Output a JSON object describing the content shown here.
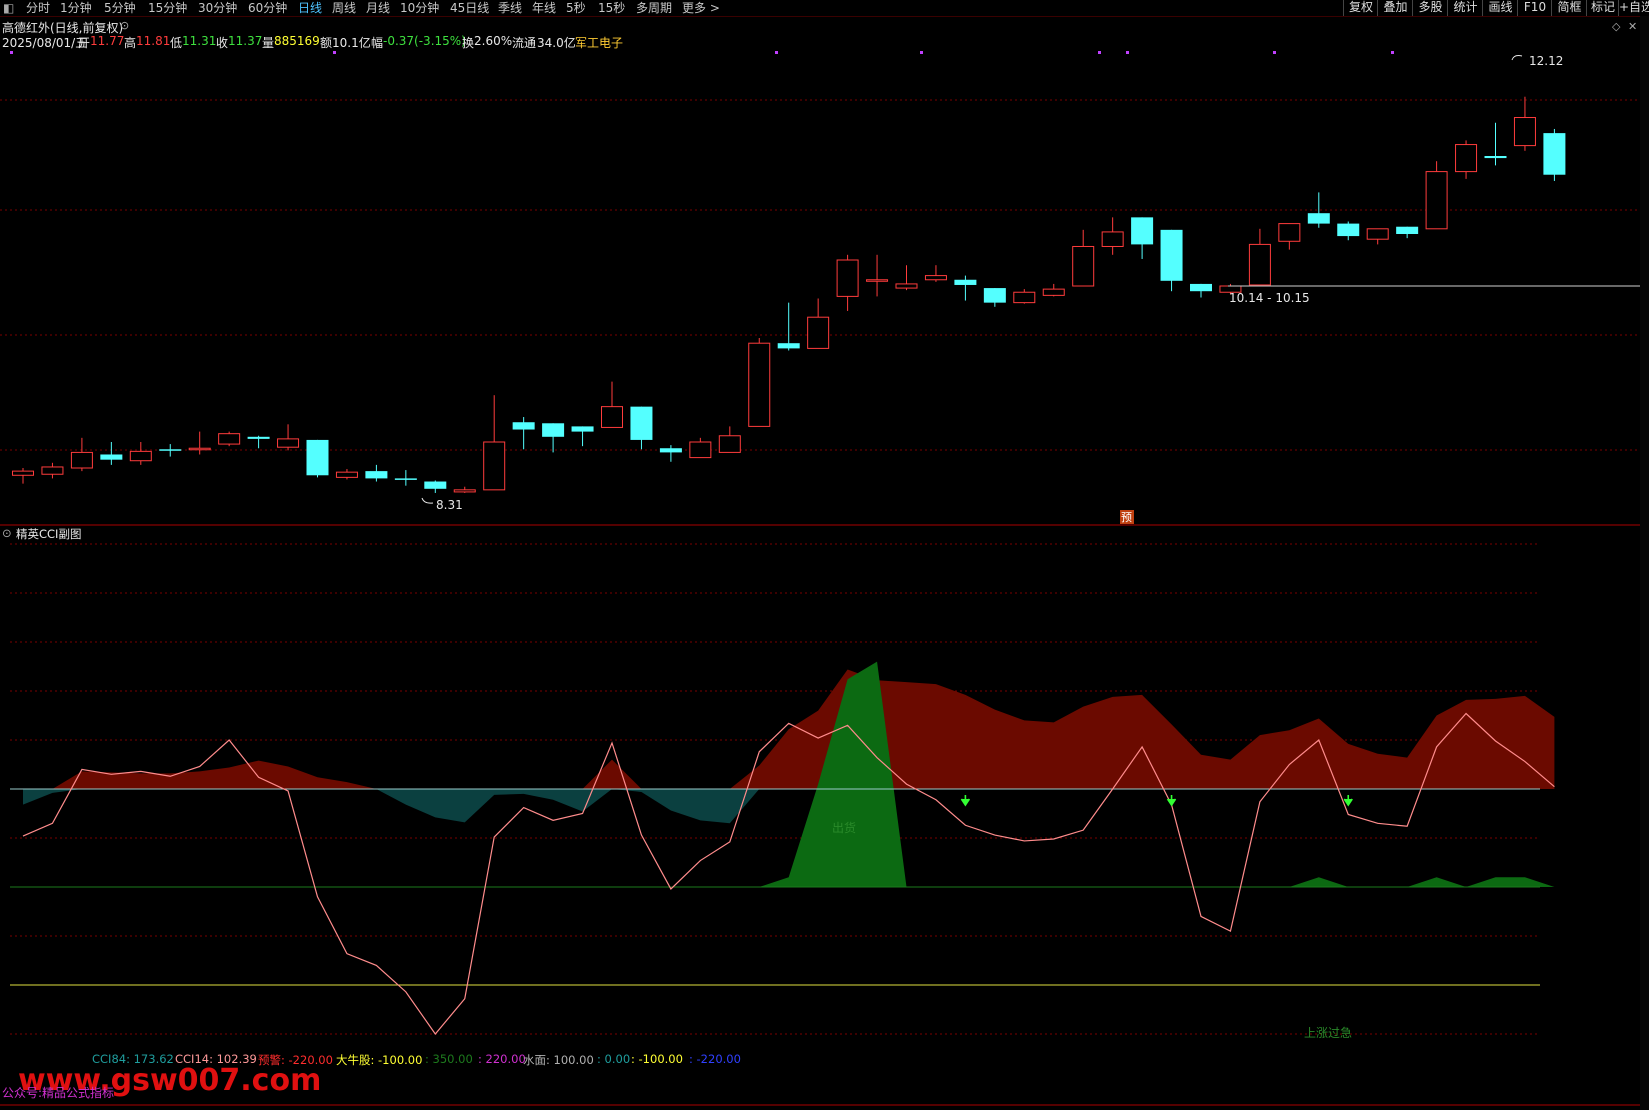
{
  "toolbar": {
    "periods": [
      "分时",
      "1分钟",
      "5分钟",
      "15分钟",
      "30分钟",
      "60分钟",
      "日线",
      "周线",
      "月线",
      "10分钟",
      "45日线",
      "季线",
      "年线",
      "5秒",
      "15秒",
      "多周期",
      "更多 >"
    ],
    "active_period": "日线",
    "right_buttons": [
      "复权",
      "叠加",
      "多股",
      "统计",
      "画线",
      "F10",
      "简框",
      "标记",
      "+自选"
    ]
  },
  "stock": {
    "title": "高德红外(日线,前复权)",
    "date": "2025/08/01/五",
    "open_label": "开",
    "open": "11.77",
    "high_label": "高",
    "high": "11.81",
    "low_label": "低",
    "low": "11.31",
    "close_label": "收",
    "close": "11.37",
    "volume_label": "量",
    "volume": "885169",
    "amount_label": "额",
    "amount": "10.1亿",
    "change_label": "幅",
    "change": "-0.37(-3.15%)",
    "turnover_label": "换",
    "turnover": "2.60%",
    "float_label": "流通",
    "float": "34.0亿",
    "sector": "军工电子"
  },
  "price_marks": {
    "high_label": "12.12",
    "low_label": "8.31",
    "range_label": "10.14 - 10.15",
    "pre_badge": "预"
  },
  "indicator": {
    "name": "精英CCI副图",
    "legend": [
      {
        "text": "CCI84: 173.62",
        "color": "#1f9e9e"
      },
      {
        "text": "CCI14: 102.39",
        "color": "#ff9a9a"
      },
      {
        "text": "预警: -220.00",
        "color": "#ff2d2d"
      },
      {
        "text": "大牛股: -100.00",
        "color": "#ffff33"
      },
      {
        "text": ": 350.00",
        "color": "#1d7a1d"
      },
      {
        "text": ": 220.00",
        "color": "#d030d0"
      },
      {
        "text": "水面: 100.00",
        "color": "#b0b0b0"
      },
      {
        "text": ": 0.00",
        "color": "#1f9e9e"
      },
      {
        "text": ": -100.00",
        "color": "#ffff33"
      },
      {
        "text": ": -220.00",
        "color": "#3040ff"
      }
    ],
    "label_chuhuo": "出货",
    "label_shangzhang": "上涨过急",
    "watermark": "www.gsw007.com",
    "footer": "公众号:精品公式指标"
  },
  "colors": {
    "up": "#ff3c3c",
    "down": "#54ffff",
    "grid": "#7a0000",
    "cci84_fill_pos": "#6b0a00",
    "cci84_fill_neg": "#0b4040",
    "green_area": "#0c6a12",
    "cci14_line": "#ff8c8c"
  },
  "chart_data": {
    "type": "candlestick",
    "candles": [
      {
        "o": 8.48,
        "h": 8.55,
        "l": 8.4,
        "c": 8.52
      },
      {
        "o": 8.49,
        "h": 8.6,
        "l": 8.45,
        "c": 8.56
      },
      {
        "o": 8.55,
        "h": 8.84,
        "l": 8.52,
        "c": 8.7
      },
      {
        "o": 8.68,
        "h": 8.8,
        "l": 8.58,
        "c": 8.63
      },
      {
        "o": 8.62,
        "h": 8.8,
        "l": 8.58,
        "c": 8.71
      },
      {
        "o": 8.73,
        "h": 8.78,
        "l": 8.66,
        "c": 8.72
      },
      {
        "o": 8.73,
        "h": 8.9,
        "l": 8.68,
        "c": 8.74
      },
      {
        "o": 8.78,
        "h": 8.9,
        "l": 8.76,
        "c": 8.88
      },
      {
        "o": 8.85,
        "h": 8.86,
        "l": 8.74,
        "c": 8.83
      },
      {
        "o": 8.75,
        "h": 8.97,
        "l": 8.72,
        "c": 8.83
      },
      {
        "o": 8.82,
        "h": 8.82,
        "l": 8.46,
        "c": 8.48
      },
      {
        "o": 8.46,
        "h": 8.54,
        "l": 8.44,
        "c": 8.51
      },
      {
        "o": 8.52,
        "h": 8.58,
        "l": 8.42,
        "c": 8.45
      },
      {
        "o": 8.45,
        "h": 8.53,
        "l": 8.38,
        "c": 8.44
      },
      {
        "o": 8.42,
        "h": 8.43,
        "l": 8.31,
        "c": 8.35
      },
      {
        "o": 8.32,
        "h": 8.37,
        "l": 8.31,
        "c": 8.34
      },
      {
        "o": 8.34,
        "h": 9.25,
        "l": 8.34,
        "c": 8.8
      },
      {
        "o": 8.99,
        "h": 9.04,
        "l": 8.73,
        "c": 8.92
      },
      {
        "o": 8.98,
        "h": 8.98,
        "l": 8.7,
        "c": 8.85
      },
      {
        "o": 8.95,
        "h": 8.95,
        "l": 8.76,
        "c": 8.9
      },
      {
        "o": 8.94,
        "h": 9.38,
        "l": 8.94,
        "c": 9.14
      },
      {
        "o": 9.14,
        "h": 9.14,
        "l": 8.73,
        "c": 8.82
      },
      {
        "o": 8.74,
        "h": 8.77,
        "l": 8.61,
        "c": 8.7
      },
      {
        "o": 8.65,
        "h": 8.84,
        "l": 8.65,
        "c": 8.8
      },
      {
        "o": 8.7,
        "h": 8.95,
        "l": 8.7,
        "c": 8.86
      },
      {
        "o": 8.95,
        "h": 9.8,
        "l": 8.95,
        "c": 9.75
      },
      {
        "o": 9.75,
        "h": 10.14,
        "l": 9.68,
        "c": 9.7
      },
      {
        "o": 9.7,
        "h": 10.18,
        "l": 9.7,
        "c": 10.0
      },
      {
        "o": 10.2,
        "h": 10.6,
        "l": 10.06,
        "c": 10.55
      },
      {
        "o": 10.36,
        "h": 10.6,
        "l": 10.2,
        "c": 10.36
      },
      {
        "o": 10.28,
        "h": 10.5,
        "l": 10.26,
        "c": 10.32
      },
      {
        "o": 10.36,
        "h": 10.5,
        "l": 10.34,
        "c": 10.4
      },
      {
        "o": 10.36,
        "h": 10.4,
        "l": 10.16,
        "c": 10.31
      },
      {
        "o": 10.28,
        "h": 10.28,
        "l": 10.1,
        "c": 10.14
      },
      {
        "o": 10.14,
        "h": 10.27,
        "l": 10.13,
        "c": 10.24
      },
      {
        "o": 10.21,
        "h": 10.32,
        "l": 10.2,
        "c": 10.27
      },
      {
        "o": 10.3,
        "h": 10.84,
        "l": 10.3,
        "c": 10.68
      },
      {
        "o": 10.68,
        "h": 10.96,
        "l": 10.6,
        "c": 10.82
      },
      {
        "o": 10.96,
        "h": 10.96,
        "l": 10.56,
        "c": 10.7
      },
      {
        "o": 10.84,
        "h": 10.84,
        "l": 10.25,
        "c": 10.35
      },
      {
        "o": 10.32,
        "h": 10.32,
        "l": 10.19,
        "c": 10.25
      },
      {
        "o": 10.24,
        "h": 10.32,
        "l": 10.22,
        "c": 10.3
      },
      {
        "o": 10.31,
        "h": 10.85,
        "l": 10.31,
        "c": 10.7
      },
      {
        "o": 10.73,
        "h": 10.9,
        "l": 10.65,
        "c": 10.9
      },
      {
        "o": 11.0,
        "h": 11.2,
        "l": 10.86,
        "c": 10.9
      },
      {
        "o": 10.9,
        "h": 10.92,
        "l": 10.74,
        "c": 10.78
      },
      {
        "o": 10.75,
        "h": 10.85,
        "l": 10.7,
        "c": 10.85
      },
      {
        "o": 10.87,
        "h": 10.87,
        "l": 10.76,
        "c": 10.8
      },
      {
        "o": 10.85,
        "h": 11.5,
        "l": 10.85,
        "c": 11.4
      },
      {
        "o": 11.4,
        "h": 11.7,
        "l": 11.33,
        "c": 11.66
      },
      {
        "o": 11.55,
        "h": 11.87,
        "l": 11.46,
        "c": 11.53
      },
      {
        "o": 11.65,
        "h": 12.12,
        "l": 11.6,
        "c": 11.92
      },
      {
        "o": 11.77,
        "h": 11.81,
        "l": 11.31,
        "c": 11.37
      }
    ],
    "ylim": [
      8.05,
      12.55
    ],
    "cci84": [
      84,
      96,
      118,
      117,
      116,
      116,
      118,
      122,
      129,
      123,
      112,
      107,
      100,
      84,
      71,
      66,
      94,
      95,
      89,
      77,
      130,
      97,
      78,
      68,
      65,
      124,
      161,
      180,
      222,
      211,
      209,
      207,
      196,
      181,
      170,
      168,
      184,
      194,
      196,
      166,
      135,
      130,
      155,
      160,
      172,
      146,
      136,
      132,
      175,
      191,
      192,
      195,
      173.62
    ],
    "cci14": [
      52,
      65,
      120,
      115,
      118,
      113,
      123,
      150,
      112,
      98,
      -10,
      -68,
      -80,
      -107,
      -150,
      -114,
      51,
      81,
      68,
      75,
      147,
      53,
      -2,
      27,
      46,
      138,
      167,
      152,
      165,
      132,
      105,
      89,
      63,
      53,
      47,
      49,
      58,
      100,
      143,
      84,
      -30,
      -45,
      87,
      125,
      150,
      74,
      65,
      62,
      143,
      177,
      149,
      128,
      102.39
    ],
    "green_area": [
      0,
      0,
      0,
      0,
      0,
      0,
      0,
      0,
      0,
      0,
      0,
      0,
      0,
      0,
      0,
      0,
      0,
      0,
      0,
      0,
      0,
      0,
      0,
      0,
      0,
      0,
      10,
      105,
      212,
      230,
      0,
      0,
      0,
      0,
      0,
      0,
      0,
      0,
      0,
      0,
      0,
      0,
      0,
      0,
      10,
      0,
      0,
      0,
      10,
      0,
      10,
      10,
      0
    ],
    "arrows": [
      32,
      39,
      45
    ],
    "grid_lines": [
      350,
      300,
      250,
      200,
      150,
      100,
      50,
      0,
      -50,
      -100,
      -150
    ]
  }
}
